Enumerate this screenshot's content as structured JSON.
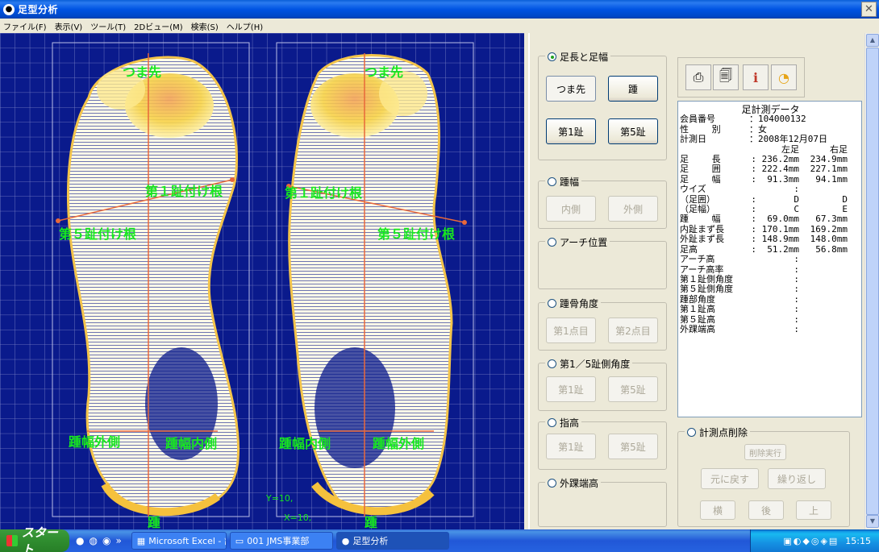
{
  "window": {
    "title": "足型分析",
    "close_symbol": "✕"
  },
  "menu": [
    "ファイル(F)",
    "表示(V)",
    "ツール(T)",
    "2Dビュー(M)",
    "検索(S)",
    "ヘルプ(H)"
  ],
  "canvas": {
    "labels": {
      "toe_left": "つま先",
      "toe_right": "つま先",
      "mt1_left": "第１趾付け根",
      "mt5_left": "第５趾付け根",
      "mt1_right": "第１趾付け根",
      "mt5_right": "第５趾付け根",
      "heel_out_left": "踵幅外側",
      "heel_in_left": "踵幅内側",
      "heel_in_right": "踵幅内側",
      "heel_out_right": "踵幅外側",
      "heel_left": "踵",
      "heel_right": "踵"
    },
    "coord_y": "Y=10,",
    "coord_x": "X=10,"
  },
  "panel": {
    "groups": {
      "length_width": "足長と足幅",
      "heel_width": "踵幅",
      "arch": "アーチ位置",
      "heel_angle": "踵骨角度",
      "toe_angle": "第1／5趾側角度",
      "toe_height": "指高",
      "ankle": "外踝端高",
      "delete": "計測点削除"
    },
    "buttons": {
      "toe": "つま先",
      "heel": "踵",
      "toe1": "第1趾",
      "toe5": "第5趾",
      "inner": "内側",
      "outer": "外側",
      "pt1": "第1点目",
      "pt2": "第2点目",
      "angle_toe1": "第1趾",
      "angle_toe5": "第5趾",
      "height_toe1": "第1趾",
      "height_toe5": "第5趾",
      "delete_exec": "削除実行",
      "undo": "元に戻す",
      "redo": "繰り返し",
      "side": "横",
      "back": "後",
      "top": "上"
    },
    "tool_icons": [
      "printer-icon",
      "print-preview-icon",
      "info-icon",
      "shoe-icon"
    ],
    "data": {
      "title": "足計測データ",
      "member_label": "会員番号",
      "member_value": "：104000132",
      "sex_label": "性　　 別",
      "sex_value": "：女",
      "date_label": "計測日",
      "date_value": "：2008年12月07日",
      "col_left": "左足",
      "col_right": "右足",
      "rows": [
        [
          "足　　 長",
          ": 236.2mm",
          "234.9mm"
        ],
        [
          "足　　 囲",
          ": 222.4mm",
          "227.1mm"
        ],
        [
          "足　　 幅",
          ":  91.3mm",
          " 94.1mm"
        ],
        [
          "ウイズ",
          ":",
          ""
        ],
        [
          "（足囲）",
          ":       D",
          "D"
        ],
        [
          "（足幅）",
          ":       C",
          "E"
        ],
        [
          "踵　　 幅",
          ":  69.0mm",
          " 67.3mm"
        ],
        [
          "内趾まず長",
          ": 170.1mm",
          "169.2mm"
        ],
        [
          "外趾まず長",
          ": 148.9mm",
          "148.0mm"
        ],
        [
          "足高",
          ":  51.2mm",
          " 56.8mm"
        ],
        [
          "アーチ高",
          ":",
          ""
        ],
        [
          "アーチ高率",
          ":",
          ""
        ],
        [
          "第１趾側角度",
          ":",
          ""
        ],
        [
          "第５趾側角度",
          ":",
          ""
        ],
        [
          "踵部角度",
          ":",
          ""
        ],
        [
          "",
          "",
          ""
        ],
        [
          "第１趾高",
          ":",
          ""
        ],
        [
          "第５趾高",
          ":",
          ""
        ],
        [
          "外踝端高",
          ":",
          ""
        ]
      ]
    }
  },
  "taskbar": {
    "start": "スタート",
    "tasks": [
      "Microsoft Excel - 計...",
      "001 JMS事業部",
      "足型分析"
    ],
    "clock": "15:15"
  }
}
